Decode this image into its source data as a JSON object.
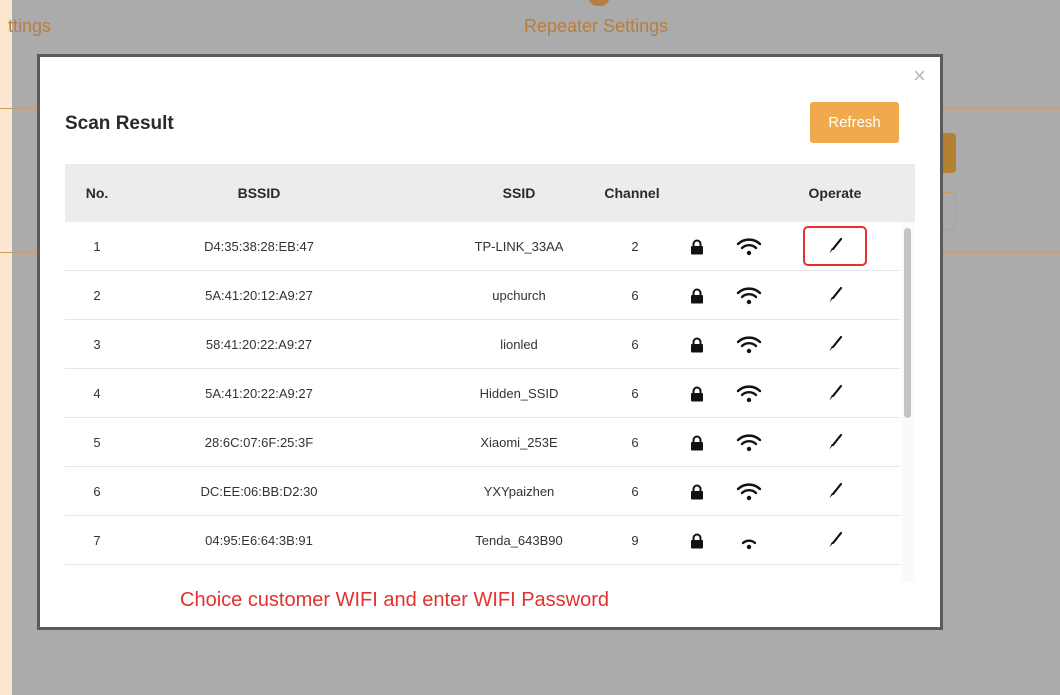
{
  "background": {
    "tab_left": "ttings",
    "tab_center": "Repeater Settings"
  },
  "modal": {
    "close_symbol": "×",
    "title": "Scan Result",
    "refresh_label": "Refresh",
    "note": "Choice customer WIFI and enter WIFI Password"
  },
  "table": {
    "headers": [
      "No.",
      "BSSID",
      "SSID",
      "Channel",
      "Operate"
    ],
    "rows": [
      {
        "no": "1",
        "bssid": "D4:35:38:28:EB:47",
        "ssid": "TP-LINK_33AA",
        "channel": "2",
        "signal": "strong",
        "highlight": true
      },
      {
        "no": "2",
        "bssid": "5A:41:20:12:A9:27",
        "ssid": "upchurch",
        "channel": "6",
        "signal": "strong",
        "highlight": false
      },
      {
        "no": "3",
        "bssid": "58:41:20:22:A9:27",
        "ssid": "lionled",
        "channel": "6",
        "signal": "strong",
        "highlight": false
      },
      {
        "no": "4",
        "bssid": "5A:41:20:22:A9:27",
        "ssid": "Hidden_SSID",
        "channel": "6",
        "signal": "strong",
        "highlight": false
      },
      {
        "no": "5",
        "bssid": "28:6C:07:6F:25:3F",
        "ssid": "Xiaomi_253E",
        "channel": "6",
        "signal": "strong",
        "highlight": false
      },
      {
        "no": "6",
        "bssid": "DC:EE:06:BB:D2:30",
        "ssid": "YXYpaizhen",
        "channel": "6",
        "signal": "strong",
        "highlight": false
      },
      {
        "no": "7",
        "bssid": "04:95:E6:64:3B:91",
        "ssid": "Tenda_643B90",
        "channel": "9",
        "signal": "weak",
        "highlight": false
      }
    ]
  },
  "icons": {
    "lock": "lock-icon",
    "wifi": "wifi-icon",
    "operate": "connect-pen-icon",
    "close": "close-icon"
  },
  "colors": {
    "accent": "#f0aa4c",
    "highlight": "#e3312d",
    "bg_tab_text": "#b87d3f",
    "note": "#e3312d"
  }
}
